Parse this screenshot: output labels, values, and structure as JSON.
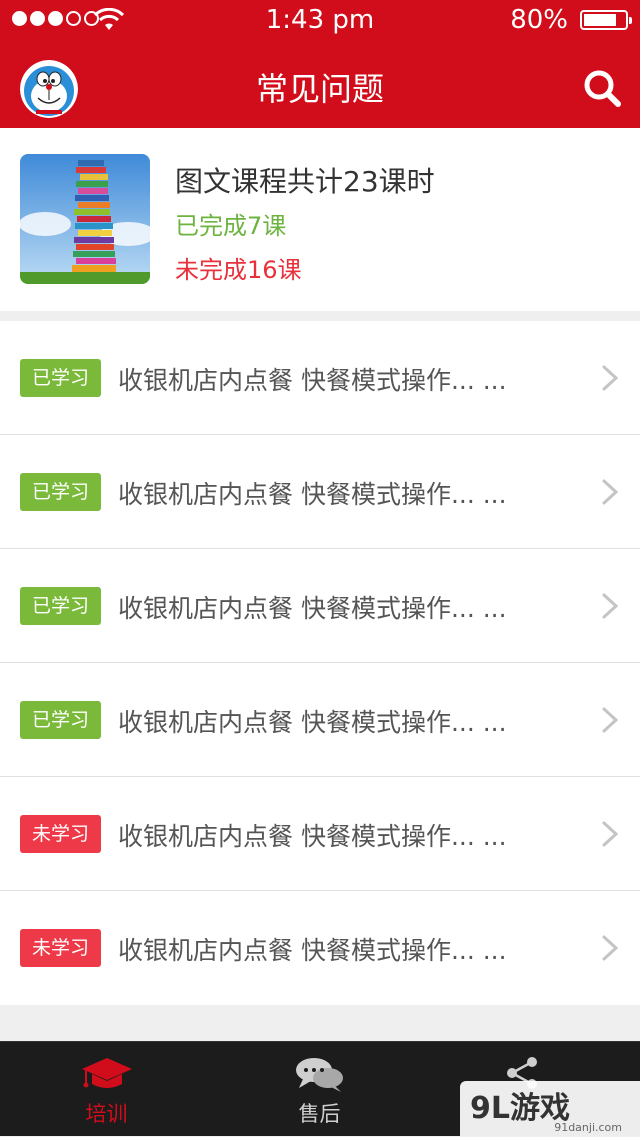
{
  "status_bar": {
    "time": "1:43 pm",
    "battery_percent": "80%",
    "battery_level": 0.8,
    "signal_bars_filled": 3,
    "signal_bars_total": 5
  },
  "nav": {
    "title": "常见问题",
    "avatar_icon": "doraemon-avatar",
    "search_icon": "search-icon"
  },
  "summary": {
    "title": "图文课程共计23课时",
    "completed": "已完成7课",
    "incomplete": "未完成16课",
    "thumbnail": "book-stack-image",
    "colors": {
      "completed": "#6db33f",
      "incomplete": "#e8313b"
    }
  },
  "lessons": [
    {
      "status": "已学习",
      "status_type": "learned",
      "title": "收银机店内点餐 快餐模式操作... ..."
    },
    {
      "status": "已学习",
      "status_type": "learned",
      "title": "收银机店内点餐 快餐模式操作... ..."
    },
    {
      "status": "已学习",
      "status_type": "learned",
      "title": "收银机店内点餐 快餐模式操作... ..."
    },
    {
      "status": "已学习",
      "status_type": "learned",
      "title": "收银机店内点餐 快餐模式操作... ..."
    },
    {
      "status": "未学习",
      "status_type": "unlearned",
      "title": "收银机店内点餐 快餐模式操作... ..."
    },
    {
      "status": "未学习",
      "status_type": "unlearned",
      "title": "收银机店内点餐 快餐模式操作... ..."
    }
  ],
  "tabs": [
    {
      "label": "培训",
      "icon": "graduation-cap-icon",
      "active": true
    },
    {
      "label": "售后",
      "icon": "chat-bubbles-icon",
      "active": false
    },
    {
      "label": "",
      "icon": "share-icon",
      "active": false
    }
  ],
  "watermark": {
    "text": "9L游戏",
    "sub": "91danji.com"
  },
  "colors": {
    "brand_red": "#d20d1b",
    "learned_badge": "#7ab93a",
    "unlearned_badge": "#ee3a48",
    "tabbar_bg": "#1c1c1c"
  }
}
